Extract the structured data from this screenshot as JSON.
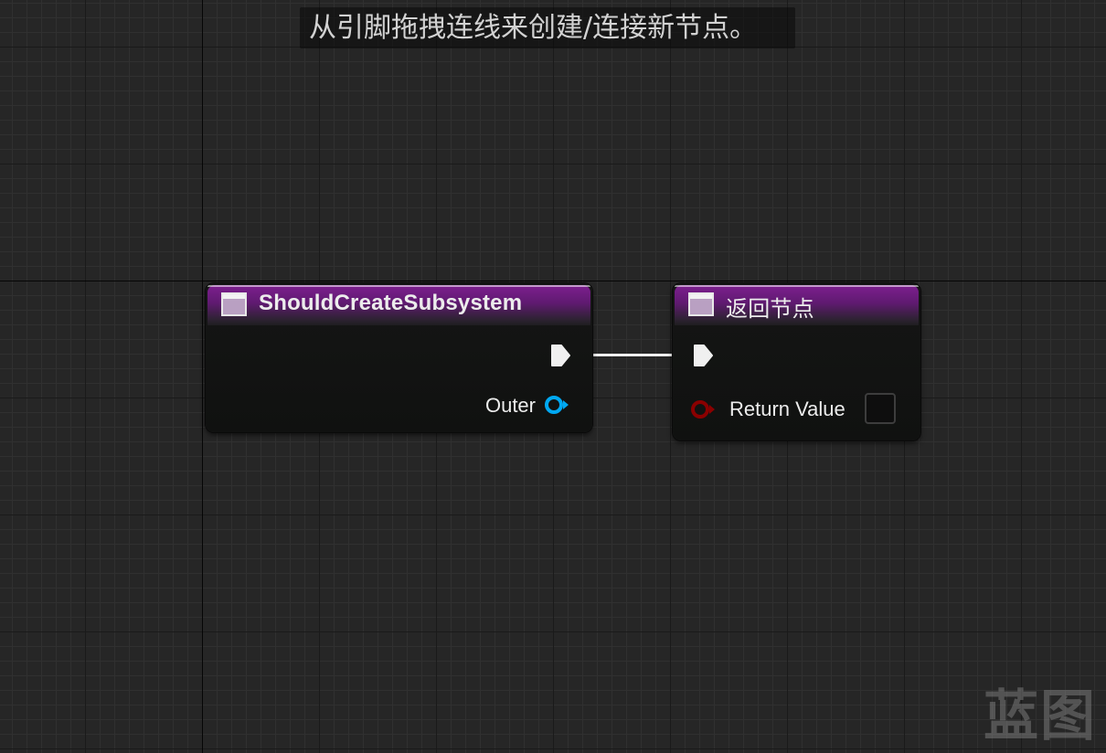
{
  "hint": {
    "text": "从引脚拖拽连线来创建/连接新节点。"
  },
  "nodes": {
    "entry": {
      "title": "ShouldCreateSubsystem",
      "pins": {
        "outer_label": "Outer"
      }
    },
    "return": {
      "title": "返回节点",
      "pins": {
        "return_value_label": "Return Value"
      }
    }
  },
  "watermark": "蓝图",
  "colors": {
    "header_purple": "#7d1f8f",
    "object_pin": "#00a8f2",
    "bool_pin": "#8a0000",
    "exec_pin": "#f0f0f0",
    "canvas": "#262626"
  },
  "icons": {
    "function": "function-icon",
    "exec": "exec-pin-icon",
    "object": "object-pin-icon",
    "bool": "bool-pin-icon"
  }
}
